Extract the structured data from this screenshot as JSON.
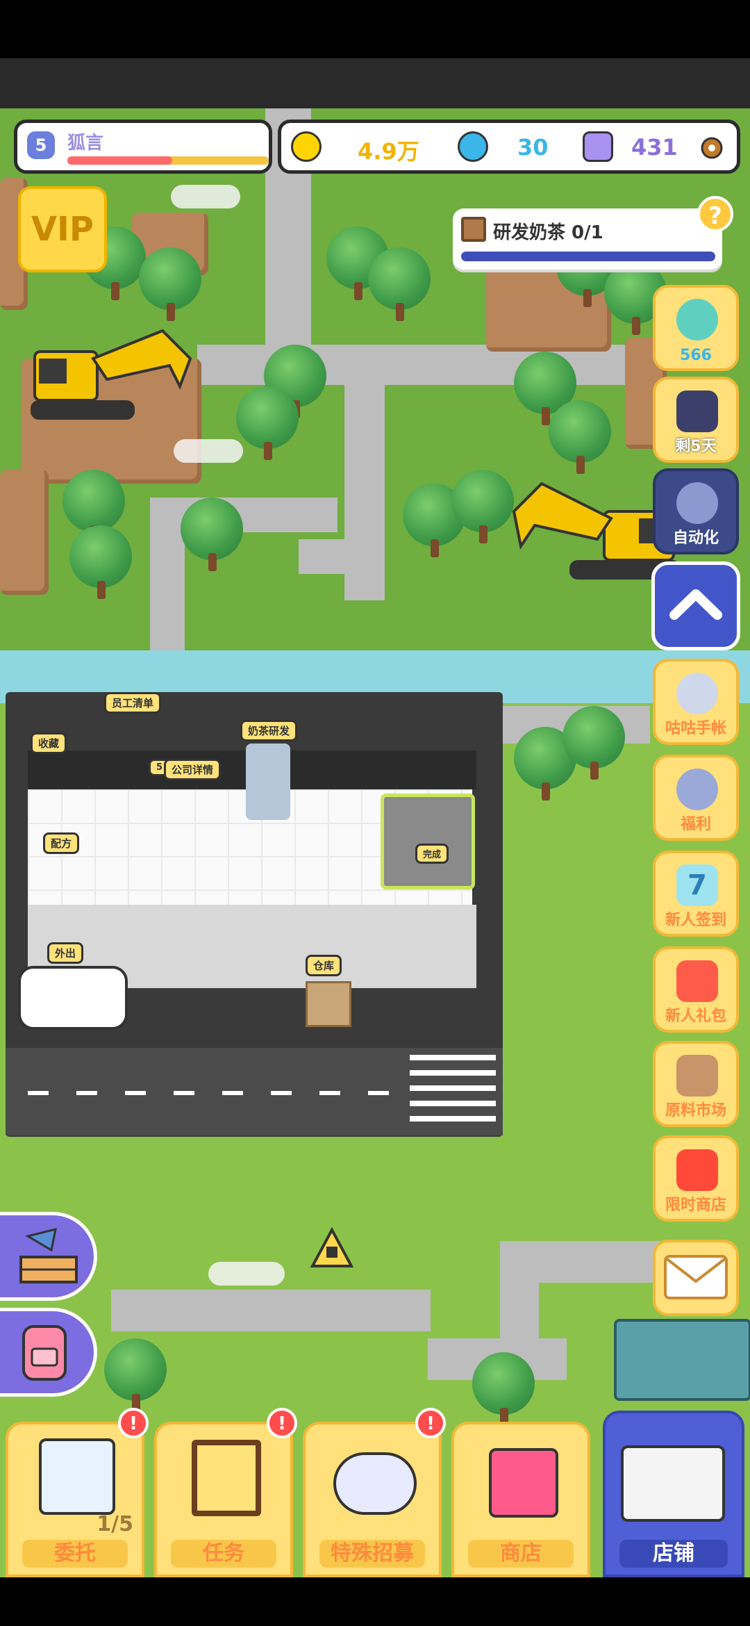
{
  "player": {
    "level": "5",
    "name": "狐言",
    "xp_progress": 0.52
  },
  "currencies": [
    {
      "icon": "gold-coin-icon",
      "value": "4.9万",
      "color": "#f0b400"
    },
    {
      "icon": "potion-icon",
      "value": "30",
      "color": "#3ab6e8"
    },
    {
      "icon": "gem-icon",
      "value": "431",
      "color": "#8a70d8"
    }
  ],
  "vip": {
    "label": "VIP"
  },
  "quest": {
    "title": "研发奶茶 0/1",
    "progress": 1.0
  },
  "help": {
    "label": "?"
  },
  "side_buttons": {
    "tea": {
      "label": "566"
    },
    "boost": {
      "label": "剩5天"
    },
    "auto": {
      "label": "自动化"
    },
    "handbook": {
      "label": "咕咕手帐"
    },
    "welfare": {
      "label": "福利"
    },
    "checkin": {
      "label": "新人签到",
      "badge": "7"
    },
    "giftpack": {
      "label": "新人礼包"
    },
    "market": {
      "label": "原料市场"
    },
    "limited_shop": {
      "label": "限时商店"
    }
  },
  "building_labels": {
    "staff_list": "员工清单",
    "collection": "收藏",
    "milk_tea_research": "奶茶研发",
    "company_details": "公司详情",
    "company_level": "5",
    "recipe": "配方",
    "go_out": "外出",
    "warehouse": "仓库",
    "done": "完成"
  },
  "bottom_tabs": [
    {
      "label": "委托",
      "counter": "1/5",
      "alert": "!"
    },
    {
      "label": "任务",
      "alert": "!"
    },
    {
      "label": "特殊招募",
      "alert": "!"
    },
    {
      "label": "商店"
    },
    {
      "label": "店铺",
      "active": true
    }
  ]
}
